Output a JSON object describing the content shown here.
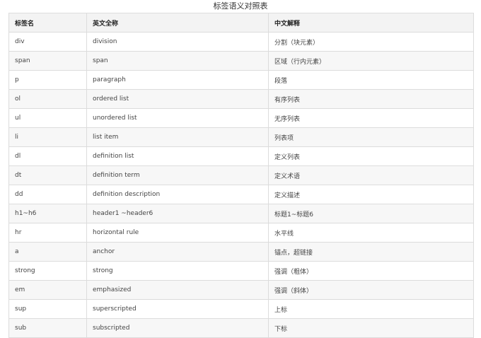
{
  "title": "标签语义对照表",
  "headers": [
    "标签名",
    "英文全称",
    "中文解释"
  ],
  "rows": [
    [
      "div",
      "division",
      "分割（块元素）"
    ],
    [
      "span",
      "span",
      "区域（行内元素）"
    ],
    [
      "p",
      "paragraph",
      "段落"
    ],
    [
      "ol",
      "ordered list",
      "有序列表"
    ],
    [
      "ul",
      "unordered list",
      "无序列表"
    ],
    [
      "li",
      "list item",
      "列表项"
    ],
    [
      "dl",
      "definition list",
      "定义列表"
    ],
    [
      "dt",
      "definition term",
      "定义术语"
    ],
    [
      "dd",
      "definition description",
      "定义描述"
    ],
    [
      "h1~h6",
      "header1 ~header6",
      "标题1~标题6"
    ],
    [
      "hr",
      "horizontal rule",
      "水平线"
    ],
    [
      "a",
      "anchor",
      "锚点，超链接"
    ],
    [
      "strong",
      "strong",
      "强调（粗体）"
    ],
    [
      "em",
      "emphasized",
      "强调（斜体）"
    ],
    [
      "sup",
      "superscripted",
      "上标"
    ],
    [
      "sub",
      "subscripted",
      "下标"
    ]
  ]
}
